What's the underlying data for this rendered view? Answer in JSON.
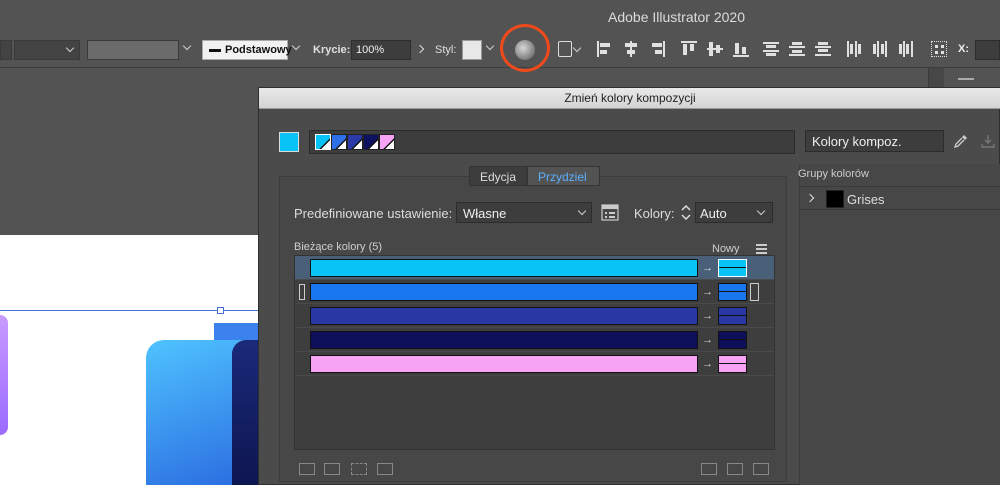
{
  "app": {
    "title": "Adobe Illustrator 2020"
  },
  "controlbar": {
    "stroke_profile": "Podstawowy",
    "opacity_label": "Krycie:",
    "opacity_value": "100%",
    "style_label": "Styl:",
    "x_label": "X:",
    "highlight_color": "#f04a1c"
  },
  "dialog": {
    "title": "Zmień kolory kompozycji",
    "harmony_name": "Kolory kompoz.",
    "harmony_swatches": [
      "#08c3f5",
      "#2f6fe8",
      "#2b3aa8",
      "#0e1260",
      "#f7a3f5"
    ],
    "tabs": [
      {
        "label": "Edycja",
        "active": false
      },
      {
        "label": "Przydziel",
        "active": true
      }
    ],
    "preset_label": "Predefiniowane ustawienie:",
    "preset_value": "Własne",
    "colors_label": "Kolory:",
    "colors_value": "Auto",
    "current_colors_label": "Bieżące kolory (5)",
    "new_label": "Nowy",
    "color_rows": [
      {
        "current": "#08c3f5",
        "new": "#08c3f5",
        "selected": true
      },
      {
        "current": "#1877ee",
        "new": "#1877ee",
        "selected": false
      },
      {
        "current": "#2a38a6",
        "new": "#2a38a6",
        "selected": false
      },
      {
        "current": "#0d0f5a",
        "new": "#0d0f5a",
        "selected": false
      },
      {
        "current": "#f7a3f5",
        "new": "#f7a3f5",
        "selected": false
      }
    ],
    "arrow_glyph": "→",
    "groups_label": "Grupy kolorów",
    "groups": [
      {
        "name": "Grises",
        "swatch": "#000000"
      }
    ]
  }
}
